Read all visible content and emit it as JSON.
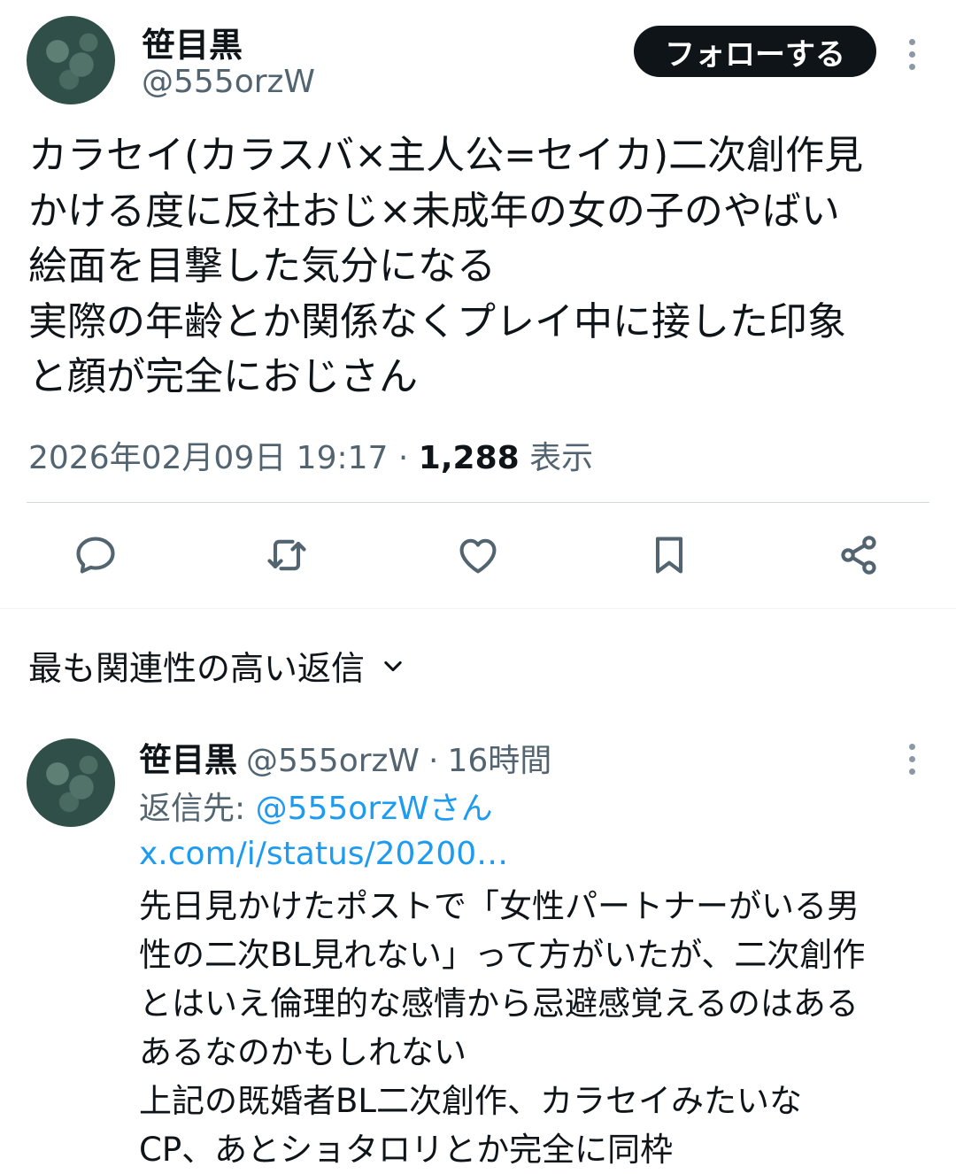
{
  "tweet": {
    "author_name": "笹目黒",
    "author_handle": "@555orzW",
    "follow_label": "フォローする",
    "text": "カラセイ(カラスバ×主人公=セイカ)二次創作見\nかける度に反社おじ×未成年の女の子のやばい\n絵面を目撃した気分になる\n実際の年齢とか関係なくプレイ中に接した印象\nと顔が完全におじさん",
    "timestamp": "2026年02月09日 19:17",
    "separator": "·",
    "views_count": "1,288",
    "views_label": "表示"
  },
  "actions": {
    "reply": "reply-icon",
    "repost": "repost-icon",
    "like": "heart-icon",
    "bookmark": "bookmark-icon",
    "share": "share-icon"
  },
  "replies_section": {
    "sort_label": "最も関連性の高い返信"
  },
  "reply": {
    "author_name": "笹目黒",
    "author_handle": "@555orzW",
    "separator": "·",
    "time": "16時間",
    "reply_to_label": "返信先:",
    "reply_to_handle": "@555orzWさん",
    "link_text": "x.com/i/status/20200…",
    "text": "先日見かけたポストで「女性パートナーがいる男\n性の二次BL見れない」って方がいたが、二次創作\nとはいえ倫理的な感情から忌避感覚えるのはある\nあるなのかもしれない\n上記の既婚者BL二次創作、カラセイみたいな\nCP、あとショタロリとか完全に同枠"
  },
  "colors": {
    "text": "#0f1419",
    "secondary": "#536471",
    "link": "#1d9bf0",
    "button_bg": "#0f1419"
  }
}
